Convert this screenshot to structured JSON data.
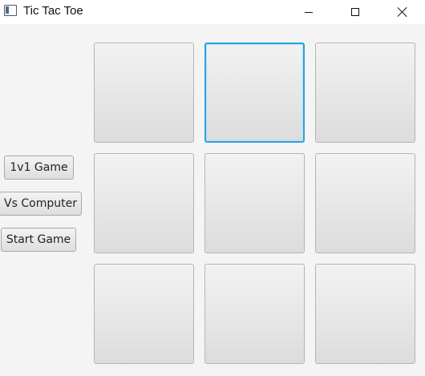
{
  "window": {
    "title": "Tic Tac Toe",
    "icon": "window-app-icon",
    "controls": [
      "minimize-icon",
      "maximize-icon",
      "close-icon"
    ]
  },
  "sidebar": {
    "buttons": [
      {
        "label": "1v1 Game"
      },
      {
        "label": "Vs Computer"
      },
      {
        "label": "Start Game"
      }
    ]
  },
  "board": {
    "cells": [
      "",
      "",
      "",
      "",
      "",
      "",
      "",
      "",
      ""
    ],
    "focused_cell": 1,
    "accent_color": "#29a3e0"
  }
}
